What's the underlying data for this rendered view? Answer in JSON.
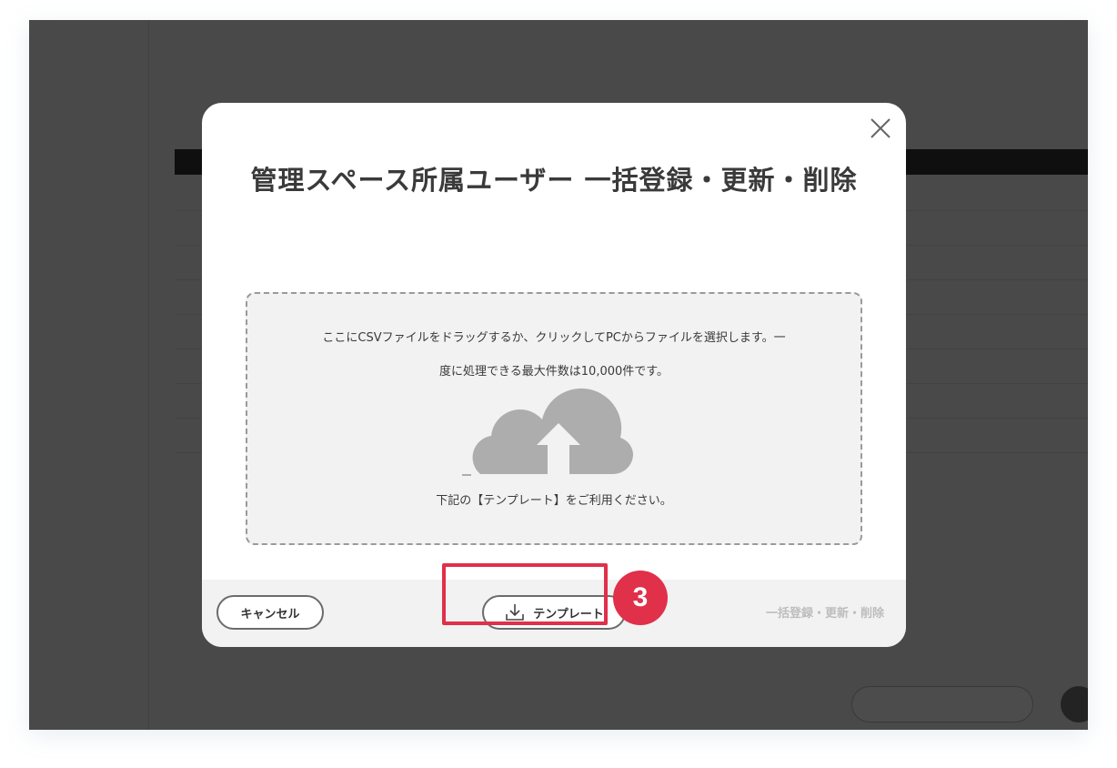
{
  "modal": {
    "title": "管理スペース所属ユーザー 一括登録・更新・削除",
    "dropzone": {
      "text": "ここにCSVファイルをドラッグするか、クリックしてPCからファイルを選択します。一度に処理できる最大件数は10,000件です。",
      "hint": "下記の【テンプレート】をご利用ください。"
    },
    "footer": {
      "cancel_label": "キャンセル",
      "template_label": "テンプレート",
      "submit_label": "一括登録・更新・削除"
    }
  },
  "annotation": {
    "step_number": "3",
    "color": "#e0304a"
  },
  "icons": [
    "close-icon",
    "cloud-upload-icon",
    "download-icon"
  ]
}
